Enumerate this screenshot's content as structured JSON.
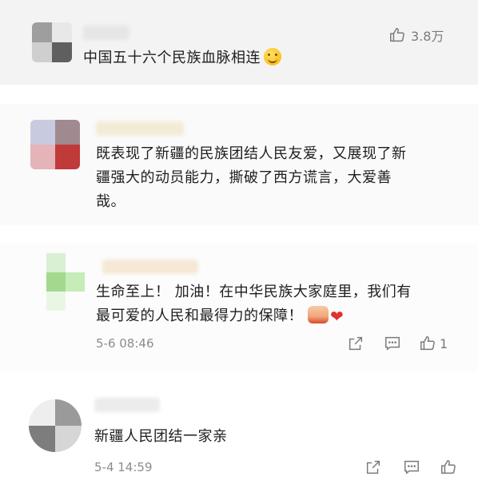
{
  "comments": [
    {
      "text": "中国五十六个民族血脉相连",
      "like_count": "3.8万"
    },
    {
      "text_lines": [
        "既表现了新疆的民族团结人民友爱，又展现了新",
        "疆强大的动员能力，撕破了西方谎言，大爱善",
        "哉。"
      ]
    },
    {
      "text_lines": [
        "生命至上！ 加油！在中华民族大家庭里，我们有",
        "最可爱的人民和最得力的保障！"
      ],
      "time": "5-6 08:46",
      "like_count": "1"
    },
    {
      "text": "新疆人民团结一家亲",
      "time": "5-4 14:59"
    }
  ],
  "icons": {
    "like": "thumbs-up-icon",
    "share": "share-icon",
    "comment": "comment-icon"
  },
  "colors": {
    "heart": "#e0312f",
    "meta": "#8c8c8c"
  }
}
